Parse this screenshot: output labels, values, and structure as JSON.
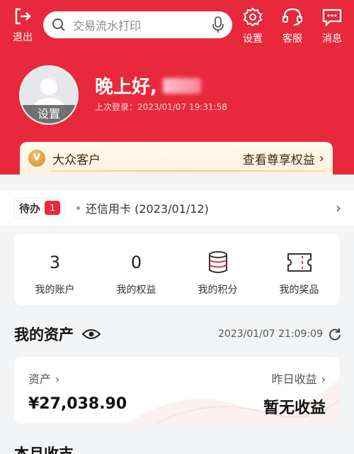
{
  "header": {
    "logout_label": "退出",
    "search_placeholder": "交易流水打印",
    "settings_label": "设置",
    "service_label": "客服",
    "messages_label": "消息"
  },
  "profile": {
    "avatar_label": "设置",
    "greeting": "晚上好,",
    "last_login": "上次登录：2023/01/07 19:31:58"
  },
  "member": {
    "badge": "V",
    "tier": "大众客户",
    "rights_link": "查看尊享权益"
  },
  "todo": {
    "tag": "待办",
    "count": "1",
    "item": "还信用卡 (2023/01/12)"
  },
  "stats": [
    {
      "value": "3",
      "label": "我的账户"
    },
    {
      "value": "0",
      "label": "我的权益"
    },
    {
      "icon": "database-icon",
      "label": "我的积分"
    },
    {
      "icon": "ticket-icon",
      "label": "我的奖品"
    }
  ],
  "assets": {
    "title": "我的资产",
    "timestamp": "2023/01/07 21:09:09",
    "asset_label": "资产",
    "asset_value": "¥27,038.90",
    "yesterday_label": "昨日收益",
    "yesterday_value": "暂无收益"
  },
  "month": {
    "title": "本月收支"
  },
  "colors": {
    "brand_red": "#e8283c",
    "gold": "#c58a25"
  }
}
